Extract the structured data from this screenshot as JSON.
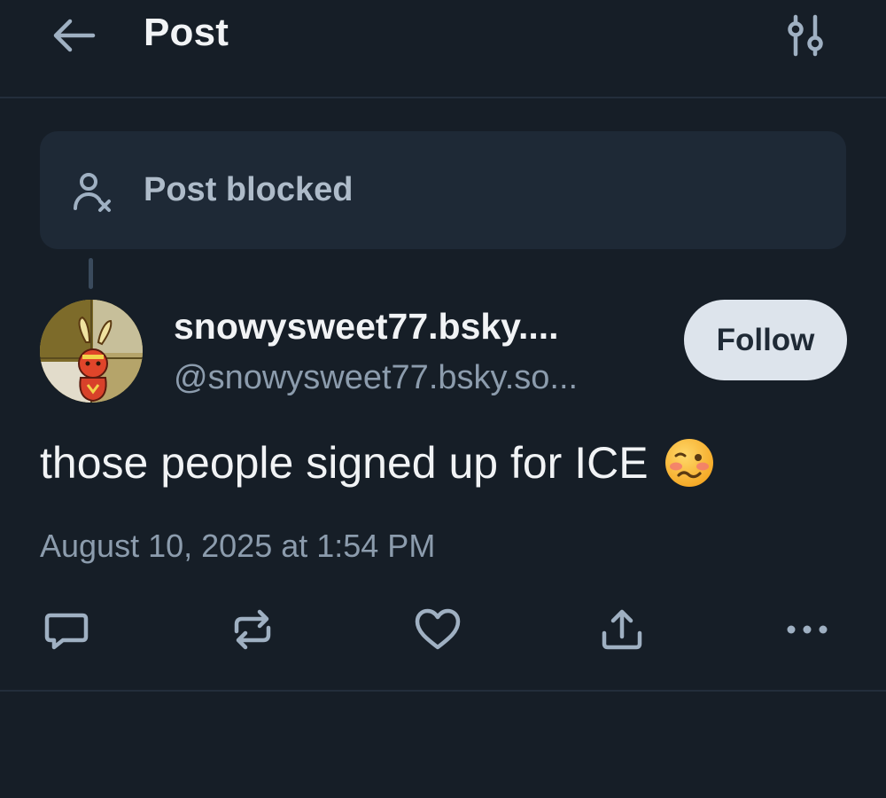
{
  "header": {
    "title": "Post",
    "back_icon": "arrow-left-icon",
    "settings_icon": "sliders-icon"
  },
  "blocked_card": {
    "icon": "person-x-icon",
    "text": "Post blocked"
  },
  "post": {
    "author": {
      "display_name": "snowysweet77.bsky....",
      "handle": "@snowysweet77.bsky.so...",
      "avatar": "avatar-image"
    },
    "follow_label": "Follow",
    "text": "those people signed up for ICE",
    "emoji": "woozy-face-emoji",
    "timestamp": "August 10, 2025 at 1:54 PM",
    "actions": [
      "reply-icon",
      "repost-icon",
      "like-icon",
      "share-icon",
      "more-icon"
    ]
  },
  "colors": {
    "background": "#161e27",
    "card": "#1e2936",
    "muted_text": "#8c9cad",
    "icon": "#9fb0c2",
    "follow_button": "#dde4ec"
  }
}
